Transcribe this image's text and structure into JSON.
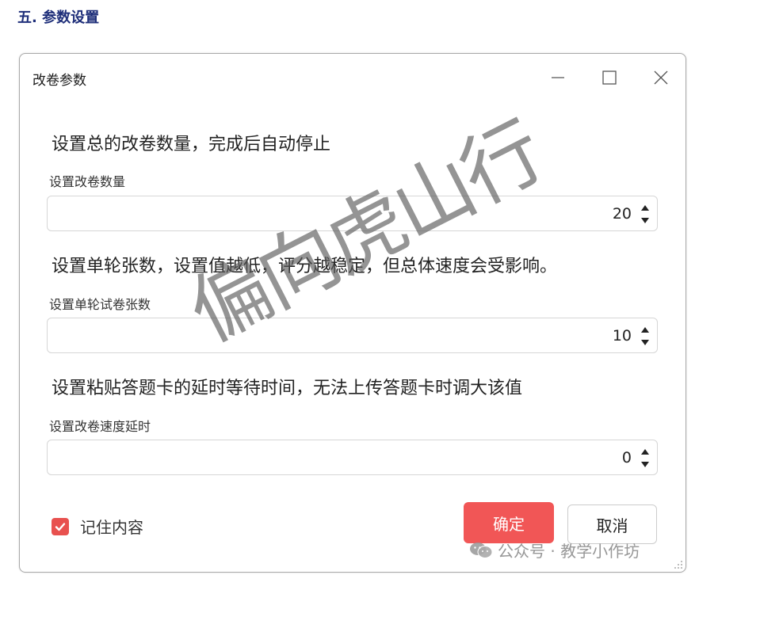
{
  "section": {
    "heading": "五. 参数设置"
  },
  "dialog": {
    "title": "改卷参数",
    "fields": [
      {
        "description": "设置总的改卷数量，完成后自动停止",
        "label": "设置改卷数量",
        "value": "20"
      },
      {
        "description": "设置单轮张数，设置值越低，评分越稳定，但总体速度会受影响。",
        "label": "设置单轮试卷张数",
        "value": "10"
      },
      {
        "description": "设置粘贴答题卡的延时等待时间，无法上传答题卡时调大该值",
        "label": "设置改卷速度延时",
        "value": "0"
      }
    ],
    "remember": {
      "label": "记住内容",
      "checked": true
    },
    "ok_label": "确定",
    "cancel_label": "取消"
  },
  "watermark": {
    "text": "偏向虎山行"
  },
  "wechat_mark": {
    "text": "公众号 · 教学小作坊",
    "icon": "wechat-icon"
  },
  "colors": {
    "accent": "#f15656",
    "heading": "#1f2f7a"
  }
}
